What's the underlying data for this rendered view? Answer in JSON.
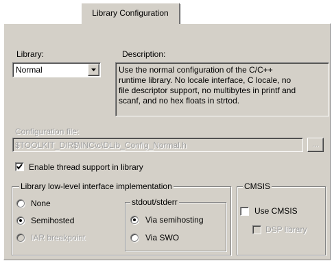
{
  "tab": {
    "label": "Library Configuration"
  },
  "library": {
    "label": "Library:",
    "selected": "Normal"
  },
  "description": {
    "label": "Description:",
    "lines": [
      "Use the normal configuration of the C/C++",
      "runtime library. No locale interface, C locale, no",
      "file descriptor support, no multibytes in printf and",
      "scanf, and no hex floats in strtod."
    ]
  },
  "config_file": {
    "label": "Configuration file:",
    "value": "$TOOLKIT_DIR$\\INC\\c\\DLib_Config_Normal.h",
    "browse_label": "..."
  },
  "thread_support": {
    "label": "Enable thread support in library",
    "checked": true
  },
  "lowlevel": {
    "title": "Library low-level interface implementation",
    "options": [
      {
        "label": "None",
        "selected": false,
        "enabled": true
      },
      {
        "label": "Semihosted",
        "selected": true,
        "enabled": true
      },
      {
        "label": "IAR breakpoint",
        "selected": false,
        "enabled": false
      }
    ]
  },
  "stdout": {
    "title": "stdout/stderr",
    "options": [
      {
        "label": "Via semihosting",
        "selected": true
      },
      {
        "label": "Via SWO",
        "selected": false
      }
    ]
  },
  "cmsis": {
    "title": "CMSIS",
    "use_cmsis": {
      "label": "Use CMSIS",
      "checked": false
    },
    "dsp_library": {
      "label": "DSP library",
      "checked": false,
      "enabled": false
    }
  }
}
